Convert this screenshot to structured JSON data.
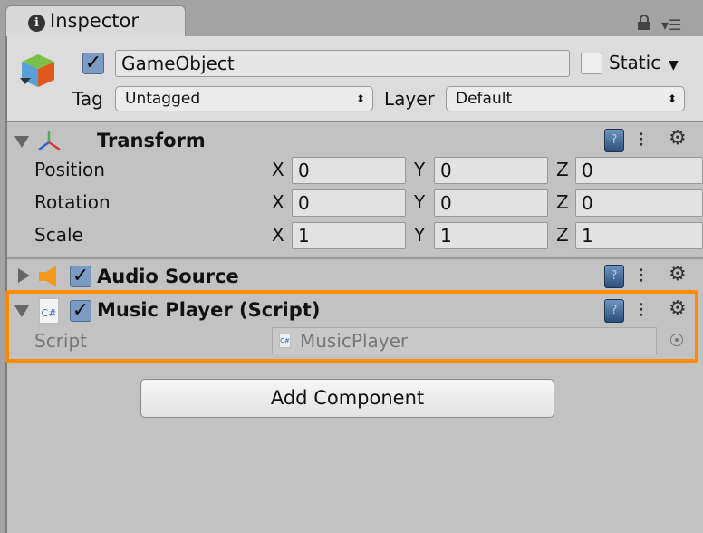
{
  "tab": {
    "title": "Inspector",
    "icon": "info-icon"
  },
  "gameobject": {
    "active": true,
    "name": "GameObject",
    "static_label": "Static",
    "static": false,
    "tag_label": "Tag",
    "tag": "Untagged",
    "layer_label": "Layer",
    "layer": "Default"
  },
  "transform": {
    "title": "Transform",
    "rows": [
      {
        "label": "Position",
        "x": "0",
        "y": "0",
        "z": "0"
      },
      {
        "label": "Rotation",
        "x": "0",
        "y": "0",
        "z": "0"
      },
      {
        "label": "Scale",
        "x": "1",
        "y": "1",
        "z": "1"
      }
    ],
    "axes": {
      "x": "X",
      "y": "Y",
      "z": "Z"
    }
  },
  "audio_source": {
    "title": "Audio Source",
    "enabled": true,
    "expanded": false
  },
  "music_player": {
    "title": "Music Player (Script)",
    "enabled": true,
    "expanded": true,
    "script_label": "Script",
    "script_value": "MusicPlayer",
    "file_icon_text": "C#"
  },
  "add_component": "Add Component",
  "colors": {
    "highlight": "#ff8c00",
    "checkbox": "#7b9bc4"
  }
}
